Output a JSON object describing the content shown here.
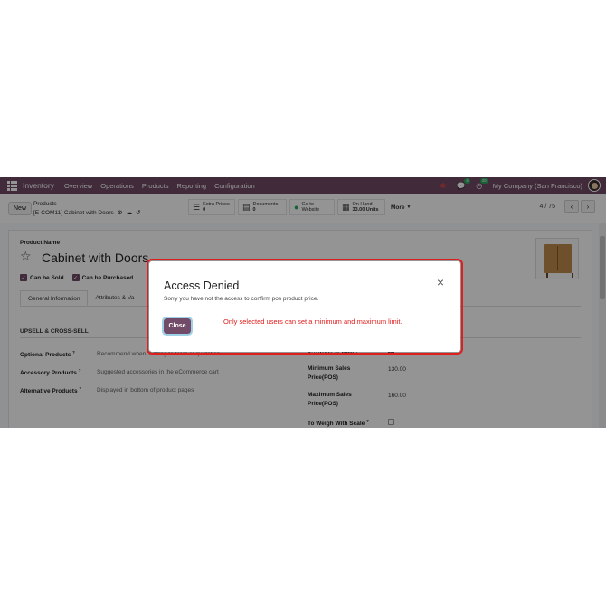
{
  "navbar": {
    "brand": "Inventory",
    "menu": [
      "Overview",
      "Operations",
      "Products",
      "Reporting",
      "Configuration"
    ],
    "chat_badge": "4",
    "activity_badge": "25",
    "company": "My Company (San Francisco)"
  },
  "control": {
    "new_label": "New",
    "breadcrumb_parent": "Products",
    "breadcrumb_current": "[E-COM11] Cabinet with Doors",
    "smart_buttons": [
      {
        "label": "Extra Prices",
        "value": "0",
        "icon": "list-icon"
      },
      {
        "label": "Documents",
        "value": "0",
        "icon": "document-icon"
      },
      {
        "label": "Go to",
        "value": "Website",
        "icon": "globe-icon"
      },
      {
        "label": "On Hand",
        "value": "33.00 Units",
        "icon": "cubes-icon"
      }
    ],
    "more_label": "More",
    "pager": "4 / 75"
  },
  "form": {
    "product_name_label": "Product Name",
    "product_name": "Cabinet with Doors",
    "can_be_sold": "Can be Sold",
    "can_be_purchased": "Can be Purchased",
    "tabs": [
      "General Information",
      "Attributes & Va"
    ],
    "section_title": "UPSELL & CROSS-SELL",
    "fields": [
      {
        "label": "Optional Products",
        "value": "Recommend when 'Adding to Cart' or quotation"
      },
      {
        "label": "Accessory Products",
        "value": "Suggested accessories in the eCommerce cart"
      },
      {
        "label": "Alternative Products",
        "value": "Displayed in bottom of product pages"
      }
    ],
    "right_fields": {
      "available_pos_label": "Available in POS",
      "min_price_label_1": "Minimum Sales",
      "min_price_label_2": "Price(POS)",
      "min_price_value": "130.00",
      "max_price_label_1": "Maximum Sales",
      "max_price_label_2": "Price(POS)",
      "max_price_value": "160.00",
      "weigh_label": "To Weigh With Scale"
    }
  },
  "dialog": {
    "title": "Access Denied",
    "message": "Sorry you have not the access to confirm pos product price.",
    "note": "Only selected users can set a minimum and maximum limit.",
    "close_label": "Close"
  }
}
